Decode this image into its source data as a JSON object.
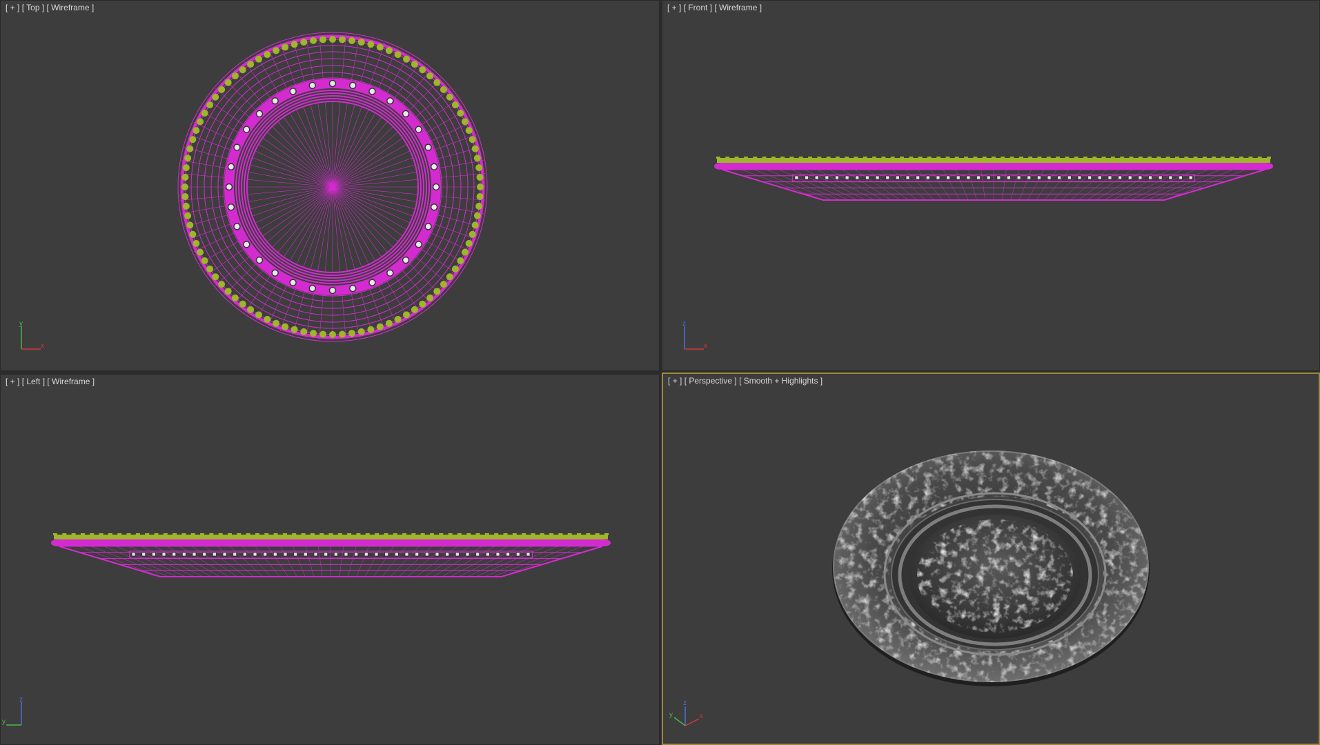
{
  "viewports": [
    {
      "id": "top",
      "plus": "[ + ]",
      "view": "[ Top ]",
      "shading": "[ Wireframe ]",
      "active": false,
      "axes": [
        "y",
        "x"
      ]
    },
    {
      "id": "front",
      "plus": "[ + ]",
      "view": "[ Front ]",
      "shading": "[ Wireframe ]",
      "active": false,
      "axes": [
        "z",
        "x"
      ]
    },
    {
      "id": "left",
      "plus": "[ + ]",
      "view": "[ Left ]",
      "shading": "[ Wireframe ]",
      "active": false,
      "axes": [
        "z",
        "y"
      ]
    },
    {
      "id": "persp",
      "plus": "[ + ]",
      "view": "[ Perspective ]",
      "shading": "[ Smooth + Highlights ]",
      "active": true,
      "axes": [
        "z",
        "y",
        "x"
      ]
    }
  ],
  "colors": {
    "viewport_bg": "#3d3d3d",
    "wire_magenta": "#d42bd0",
    "bead_green": "#9fb52a",
    "active_border": "#9c8a3e",
    "axis_x": "#d23a3a",
    "axis_y": "#4cb54c",
    "axis_z": "#4a6fd8"
  },
  "object": "ornate plate"
}
